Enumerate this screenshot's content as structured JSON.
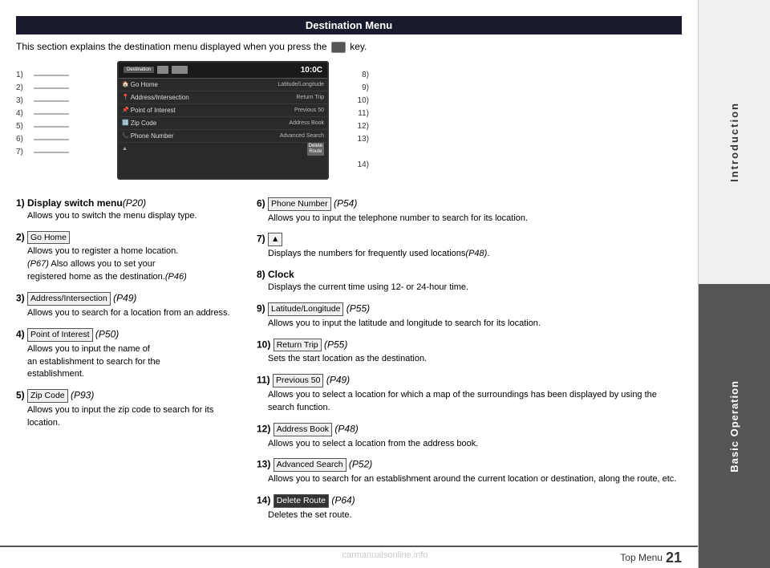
{
  "header": {
    "title": "Destination Menu"
  },
  "intro": {
    "text": "This section explains the destination menu displayed when you press the",
    "key_label": "key."
  },
  "screen": {
    "time": "10:0C",
    "left_items": [
      {
        "num": "1)",
        "icon": "house",
        "label": ""
      },
      {
        "num": "2)",
        "icon": "house",
        "label": "Go Home"
      },
      {
        "num": "3)",
        "icon": "addr",
        "label": "Address/Intersection"
      },
      {
        "num": "4)",
        "icon": "poi",
        "label": "Point of Interest"
      },
      {
        "num": "5)",
        "icon": "zip",
        "label": "Zip Code"
      },
      {
        "num": "6)",
        "icon": "phone",
        "label": "Phone Number"
      },
      {
        "num": "7)",
        "icon": "tri",
        "label": "▲"
      }
    ],
    "right_items": [
      {
        "num": "8)",
        "label": ""
      },
      {
        "num": "9)",
        "label": "Latitude/Longitude"
      },
      {
        "num": "10)",
        "label": "Return Trip"
      },
      {
        "num": "11)",
        "label": "Previous 50"
      },
      {
        "num": "12)",
        "label": "Address Book"
      },
      {
        "num": "13)",
        "label": "Advanced Search"
      },
      {
        "num": "14)",
        "label": "Delete Route"
      }
    ]
  },
  "descriptions_left": [
    {
      "num": "1)",
      "title": "Display switch menu",
      "page_ref": "(P20)",
      "body": "Allows you to switch the menu display type."
    },
    {
      "num": "2)",
      "label": "Go Home",
      "body": "Allows you to register a home location. (P67) Also allows you to set your registered home as the destination.(P46)"
    },
    {
      "num": "3)",
      "label": "Address/Intersection",
      "page_ref": "(P49)",
      "body": "Allows you to search for a location from an address."
    },
    {
      "num": "4)",
      "label": "Point of Interest",
      "page_ref": "(P50)",
      "body": "Allows you to input the name of an establishment to search for the establishment."
    },
    {
      "num": "5)",
      "label": "Zip Code",
      "page_ref": "(P93)",
      "body": "Allows you to input the zip code to search for its location."
    }
  ],
  "descriptions_right": [
    {
      "num": "6)",
      "label": "Phone Number",
      "page_ref": "(P54)",
      "body": "Allows you to input the telephone number to search for its location."
    },
    {
      "num": "7)",
      "label": "▲",
      "body": "Displays the numbers for frequently used locations(P48)."
    },
    {
      "num": "8)",
      "title": "Clock",
      "body": "Displays the current time using 12- or 24-hour time."
    },
    {
      "num": "9)",
      "label": "Latitude/Longitude",
      "page_ref": "(P55)",
      "body": "Allows you to input the latitude and longitude to search for its location."
    },
    {
      "num": "10)",
      "label": "Return Trip",
      "page_ref": "(P55)",
      "body": "Sets the start location as the destination."
    },
    {
      "num": "11)",
      "label": "Previous 50",
      "page_ref": "(P49)",
      "body": "Allows you to select a location for which a map of the surroundings has been displayed by using the search function."
    },
    {
      "num": "12)",
      "label": "Address Book",
      "page_ref": "(P48)",
      "body": "Allows you to select a location from the address book."
    },
    {
      "num": "13)",
      "label": "Advanced Search",
      "page_ref": "(P52)",
      "body": "Allows you to search for an establishment around the current location or destination, along the route, etc."
    },
    {
      "num": "14)",
      "label": "Delete Route",
      "page_ref": "(P64)",
      "body": "Deletes the set route."
    }
  ],
  "sidebar": {
    "top_label": "Introduction",
    "bottom_label": "Basic Operation"
  },
  "footer": {
    "label": "Top Menu",
    "page_num": "21"
  },
  "watermark": "carmanualsonline.info"
}
